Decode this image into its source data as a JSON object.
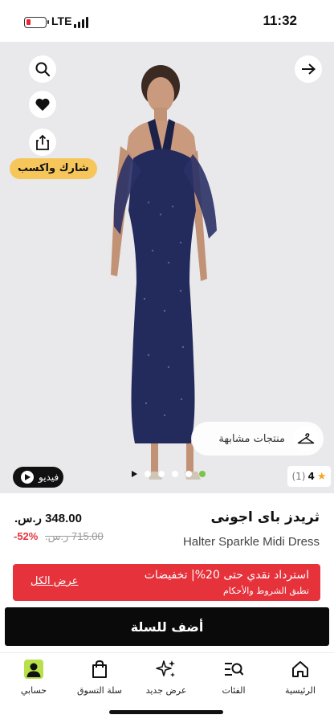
{
  "status_bar": {
    "network": "LTE",
    "time": "11:32"
  },
  "hero": {
    "icons": [
      "search-icon",
      "heart-icon",
      "share-icon",
      "forward-arrow-icon",
      "hanger-icon",
      "play-icon",
      "star-icon"
    ],
    "share_earn_label": "شارك واكسب",
    "similar_products_label": "منتجات مشابهة",
    "video_label": "فيديو",
    "rating_value": "4",
    "rating_count": "(1)",
    "gallery_images": 5,
    "gallery_active_index": 4
  },
  "product": {
    "title_ar": "ثريدز باى اجونى",
    "title_en": "Halter Sparkle Midi Dress",
    "price": "348.00 ر.س.",
    "old_price": "715.00 ر.س.",
    "discount": "-52%"
  },
  "promo": {
    "line1": "استرداد نقدي حتى 20%| تخفيضات",
    "line2": "تطبق الشروط والأحكام",
    "cta": "عرض الكل",
    "color": "#e5323b"
  },
  "add_to_cart_label": "أضف للسلة",
  "nav": {
    "items": [
      {
        "label": "الرئيسية",
        "icon": "home-icon"
      },
      {
        "label": "الفئات",
        "icon": "categories-search-icon"
      },
      {
        "label": "عرض جديد",
        "icon": "sparkle-icon"
      },
      {
        "label": "سلة التسوق",
        "icon": "shopping-bag-icon"
      },
      {
        "label": "حسابي",
        "icon": "account-icon"
      }
    ]
  }
}
